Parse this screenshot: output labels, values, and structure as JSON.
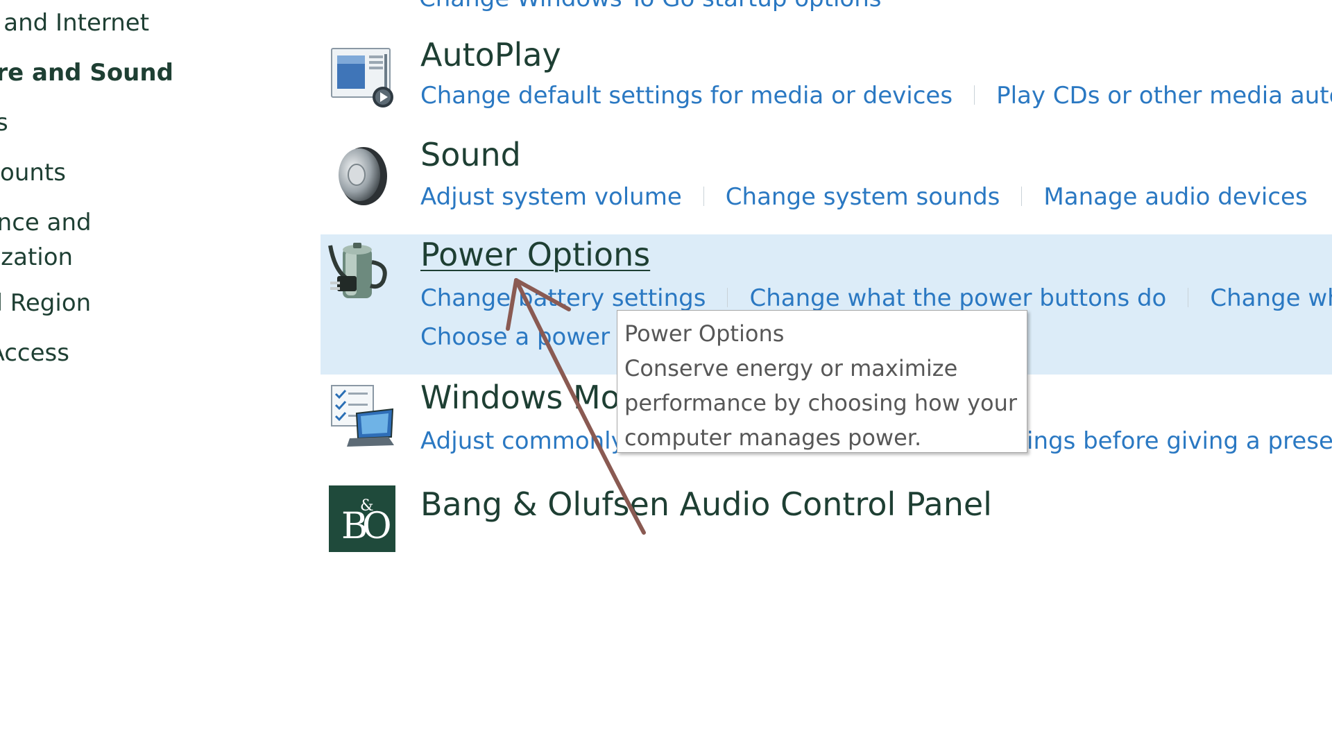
{
  "sidebar": {
    "items": [
      {
        "label": "ork and Internet"
      },
      {
        "label": "ware and Sound"
      },
      {
        "label": "ams"
      },
      {
        "label": "Accounts"
      },
      {
        "label": "arance and"
      },
      {
        "label": "nalization"
      },
      {
        "label": "and Region"
      },
      {
        "label": "of Access"
      }
    ]
  },
  "top_partial_link": "Change Windows To Go startup options",
  "categories": {
    "autoplay": {
      "title": "AutoPlay",
      "icon": "autoplay-icon",
      "tasks": [
        "Change default settings for media or devices",
        "Play CDs or other media automatic"
      ]
    },
    "sound": {
      "title": "Sound",
      "icon": "speaker-icon",
      "tasks": [
        "Adjust system volume",
        "Change system sounds",
        "Manage audio devices"
      ]
    },
    "power": {
      "title": "Power Options",
      "icon": "battery-plug-icon",
      "tasks": [
        "Change battery settings",
        "Change what the power buttons do",
        "Change when th"
      ],
      "tasks_row2": [
        "Choose a power p"
      ]
    },
    "mobility": {
      "title": "Windows Mo",
      "icon": "mobility-center-icon",
      "tasks": [
        "Adjust commonly",
        "ings before giving a present"
      ]
    },
    "bo": {
      "title": "Bang & Olufsen Audio Control Panel",
      "icon": "bang-olufsen-logo",
      "logo_text": "B&O"
    }
  },
  "tooltip": {
    "title": "Power Options",
    "lines": [
      "Conserve energy or maximize",
      "performance by choosing how your",
      "computer manages power."
    ]
  },
  "colors": {
    "link": "#2a78c2",
    "heading": "#1e3f33",
    "highlight": "#dcecf8",
    "arrow": "#8a5a52",
    "bo_bg": "#1f4a3b"
  }
}
